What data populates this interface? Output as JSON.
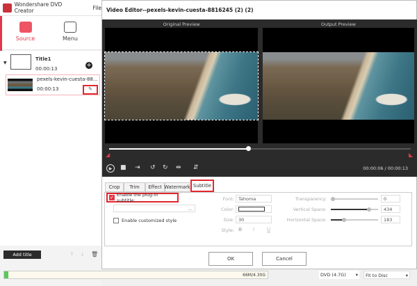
{
  "app": {
    "title": "Wondershare DVD Creator",
    "menu_file": "File",
    "steps": [
      {
        "label": "Source",
        "icon": "source-icon"
      },
      {
        "label": "Menu",
        "icon": "menu-icon"
      }
    ],
    "title_item": {
      "name": "Title1",
      "duration": "00:00:13"
    },
    "clip": {
      "name": "pexels-kevin-cuesta-88...",
      "duration": "00:00:13"
    },
    "add_title": "Add title",
    "capacity": "66M/4.30G",
    "capacity_fraction": 0.015,
    "disc_type": "DVD (4.7G)",
    "fit": "Fit to Disc"
  },
  "dialog": {
    "title": "Video Editor--pexels-kevin-cuesta-8816245 (2) (2)",
    "original_preview": "Original Preview",
    "output_preview": "Output Preview",
    "time": "00:00:06 / 00:00:13",
    "progress_fraction": 0.46,
    "tabs": [
      "Crop",
      "Trim",
      "Effect",
      "Watermark",
      "Subtitle"
    ],
    "active_tab": "Subtitle",
    "enable_plugin": "Enable the plug-in subtitle:",
    "enable_plugin_checked": true,
    "browse": "...",
    "enable_custom": "Enable customized style",
    "enable_custom_checked": false,
    "font_label": "Font:",
    "font": "Tahoma",
    "color_label": "Color:",
    "size_label": "Size:",
    "size": "30",
    "style_label": "Style:",
    "style_b": "B",
    "style_i": "I",
    "style_u": "U",
    "transparency_label": "Transparency:",
    "transparency": "0",
    "vspace_label": "Vertical Space:",
    "vspace": "434",
    "hspace_label": "Horizontal Space:",
    "hspace": "183",
    "ok": "OK",
    "cancel": "Cancel",
    "accent": "#e0282e"
  }
}
